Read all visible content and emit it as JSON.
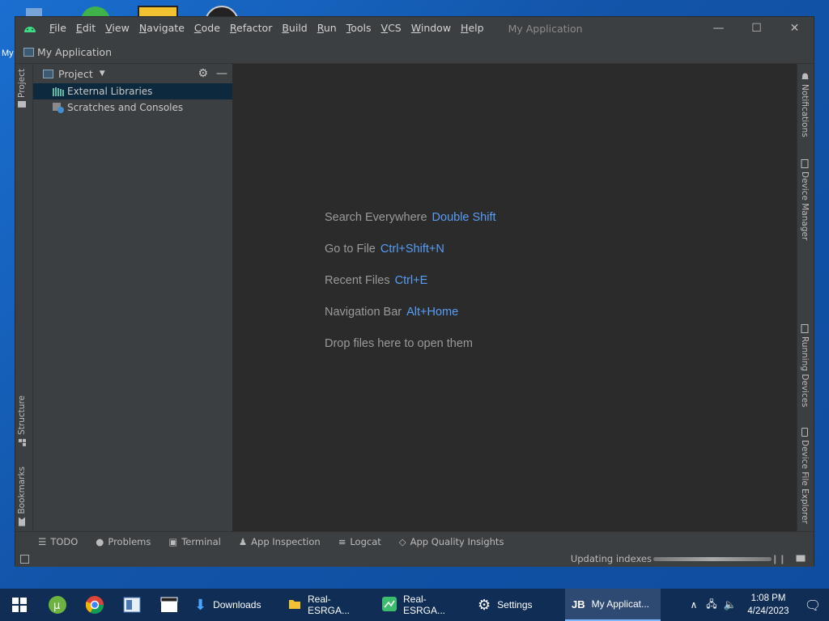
{
  "window": {
    "menu": [
      "File",
      "Edit",
      "View",
      "Navigate",
      "Code",
      "Refactor",
      "Build",
      "Run",
      "Tools",
      "VCS",
      "Window",
      "Help"
    ],
    "title": "My Application",
    "controls": {
      "minimize": "—",
      "maximize": "☐",
      "close": "✕"
    }
  },
  "navbar": {
    "project_name": "My Application"
  },
  "left_tabs": {
    "project": "Project",
    "structure": "Structure",
    "bookmarks": "Bookmarks"
  },
  "right_tabs": {
    "notifications": "Notifications",
    "device_manager": "Device Manager",
    "running_devices": "Running Devices",
    "device_file_explorer": "Device File Explorer"
  },
  "project_panel": {
    "title": "Project",
    "items": [
      {
        "label": "External Libraries",
        "icon": "library-icon",
        "selected": true
      },
      {
        "label": "Scratches and Consoles",
        "icon": "scratches-icon",
        "selected": false
      }
    ]
  },
  "editor": {
    "hints": [
      {
        "label": "Search Everywhere",
        "shortcut": "Double Shift"
      },
      {
        "label": "Go to File",
        "shortcut": "Ctrl+Shift+N"
      },
      {
        "label": "Recent Files",
        "shortcut": "Ctrl+E"
      },
      {
        "label": "Navigation Bar",
        "shortcut": "Alt+Home"
      },
      {
        "label": "Drop files here to open them",
        "shortcut": ""
      }
    ]
  },
  "bottom_tools": [
    "TODO",
    "Problems",
    "Terminal",
    "App Inspection",
    "Logcat",
    "App Quality Insights"
  ],
  "status": {
    "text": "Updating indexes",
    "progress": 1.0
  },
  "desktop": {
    "partial_label": "My"
  },
  "taskbar": {
    "apps": [
      {
        "label": "Downloads",
        "icon": "download-arrow-icon"
      },
      {
        "label": "Real-ESRGA...",
        "icon": "folder-icon"
      },
      {
        "label": "Real-ESRGA...",
        "icon": "image-app-icon"
      },
      {
        "label": "Settings",
        "icon": "gear-icon"
      },
      {
        "label": "My Applicat...",
        "icon": "jetbrains-icon",
        "active": true
      }
    ],
    "time": "1:08 PM",
    "date": "4/24/2023"
  },
  "colors": {
    "accent": "#589df6",
    "editor_bg": "#2b2b2b",
    "panel_bg": "#3c3f41",
    "selection": "#0d293e",
    "taskbar": "#0f2d55"
  }
}
